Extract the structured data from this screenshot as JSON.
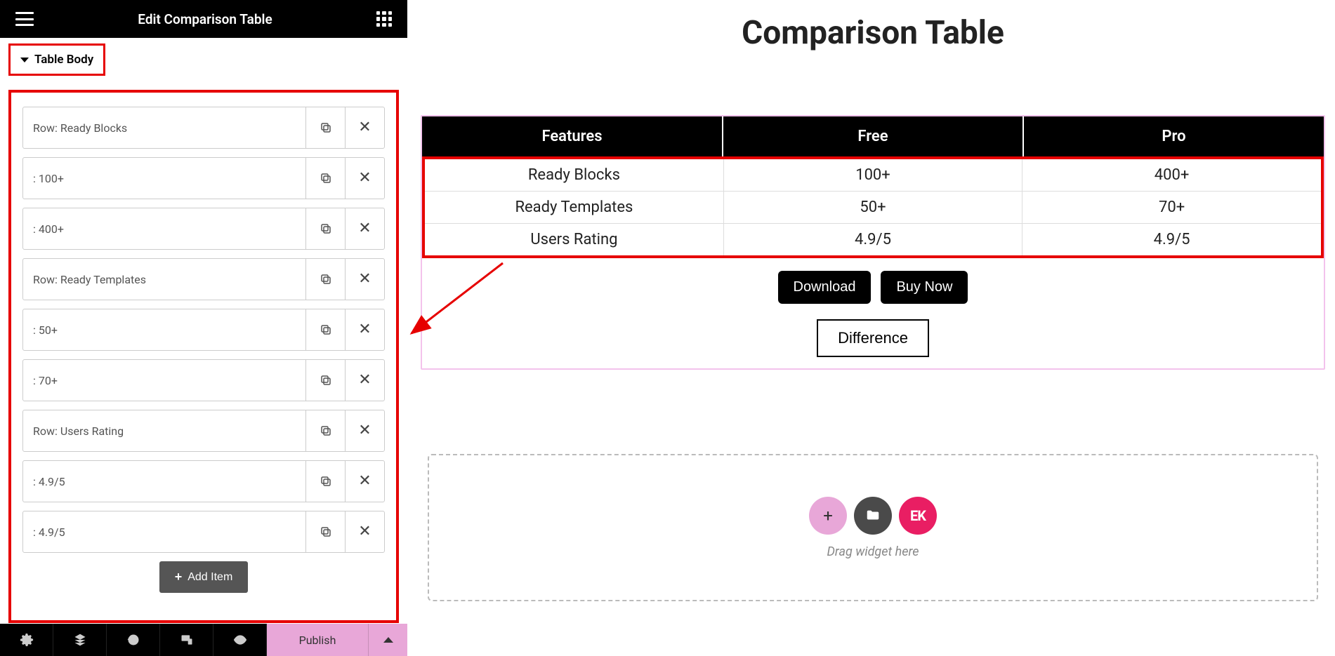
{
  "panel": {
    "title": "Edit Comparison Table",
    "section_label": "Table Body",
    "add_item_label": "Add Item",
    "publish_label": "Publish"
  },
  "items": [
    {
      "label": "Row: Ready Blocks"
    },
    {
      "label": ": 100+"
    },
    {
      "label": ": 400+"
    },
    {
      "label": "Row: Ready Templates"
    },
    {
      "label": ": 50+"
    },
    {
      "label": ": 70+"
    },
    {
      "label": "Row: Users Rating"
    },
    {
      "label": ": 4.9/5"
    },
    {
      "label": ": 4.9/5"
    }
  ],
  "canvas": {
    "title": "Comparison Table",
    "drag_text": "Drag widget here"
  },
  "table": {
    "headers": {
      "col1": "Features",
      "col2": "Free",
      "col3": "Pro"
    },
    "rows": [
      {
        "col1": "Ready Blocks",
        "col2": "100+",
        "col3": "400+"
      },
      {
        "col1": "Ready Templates",
        "col2": "50+",
        "col3": "70+"
      },
      {
        "col1": "Users Rating",
        "col2": "4.9/5",
        "col3": "4.9/5"
      }
    ],
    "buttons": {
      "download": "Download",
      "buy": "Buy Now",
      "diff": "Difference"
    }
  },
  "dz": {
    "ek_label": "EK"
  }
}
